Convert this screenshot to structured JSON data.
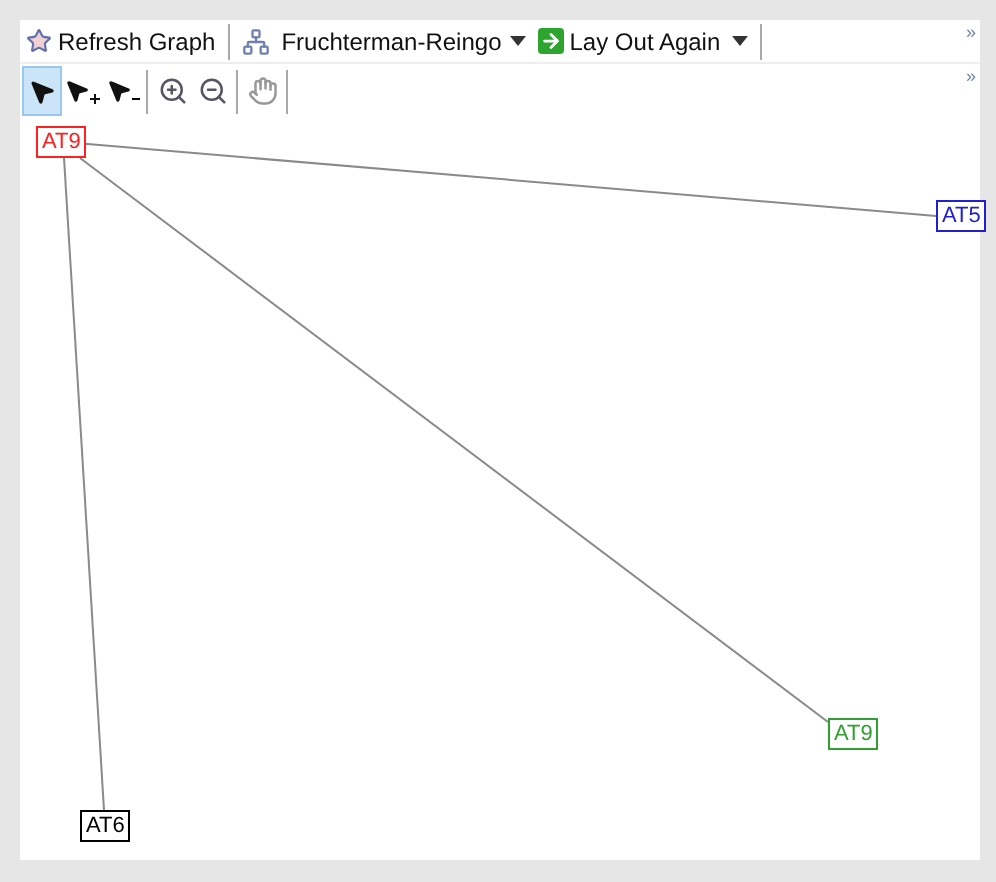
{
  "toolbar": {
    "refresh": "Refresh Graph",
    "layout": "Fruchterman-Reingo",
    "relayout": "Lay Out Again",
    "overflow": "»"
  },
  "tools": [
    {
      "kind": "select",
      "selected": true
    },
    {
      "kind": "add",
      "selected": false
    },
    {
      "kind": "remove",
      "selected": false
    },
    {
      "kind": "zoom-in",
      "selected": false
    },
    {
      "kind": "zoom-out",
      "selected": false
    },
    {
      "kind": "pan",
      "selected": false
    }
  ],
  "tools_overflow": "»",
  "nodes": [
    {
      "label": "AT9",
      "color": "#ff2020"
    },
    {
      "label": "AT5",
      "color": "#2020d0"
    },
    {
      "label": "AT9",
      "color": "#30a030"
    },
    {
      "label": "AT6",
      "color": "#000000"
    }
  ]
}
